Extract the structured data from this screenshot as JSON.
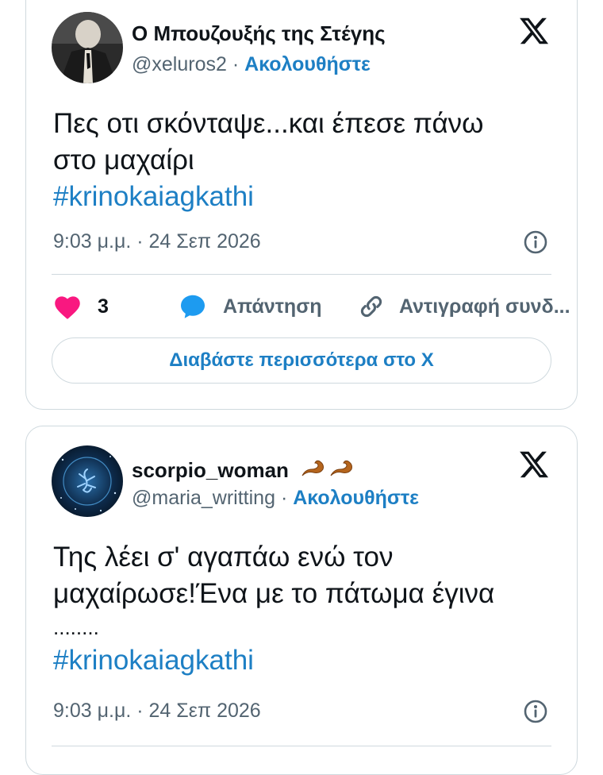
{
  "tweets": [
    {
      "display_name": "Ο Μπουζουξής της Στέγης",
      "handle": "@xeluros2",
      "separator": "·",
      "follow_label": "Ακολουθήστε",
      "text_line1": "Πες οτι σκόνταψε...και έπεσε πάνω",
      "text_line2": "στο μαχαίρι",
      "hashtag": "#krinokaiagkathi",
      "timestamp": "9:03 μ.μ. · 24 Σεπ 2026",
      "likes": "3",
      "reply_label": "Απάντηση",
      "copy_label": "Αντιγραφή συνδ...",
      "read_more": "Διαβάστε περισσότερα στο X"
    },
    {
      "display_name": "scorpio_woman",
      "handle": "@maria_writting",
      "separator": "·",
      "follow_label": "Ακολουθήστε",
      "text_line1": "Της λέει σ' αγαπάω ενώ τον",
      "text_line2": "μαχαίρωσε!Ένα με το πάτωμα έγινα",
      "text_line3": "........",
      "hashtag": "#krinokaiagkathi",
      "timestamp": "9:03 μ.μ. · 24 Σεπ 2026"
    }
  ],
  "colors": {
    "accent": "#1d7fc4",
    "like": "#f91880",
    "muted": "#536471",
    "border": "#cfd9de"
  }
}
